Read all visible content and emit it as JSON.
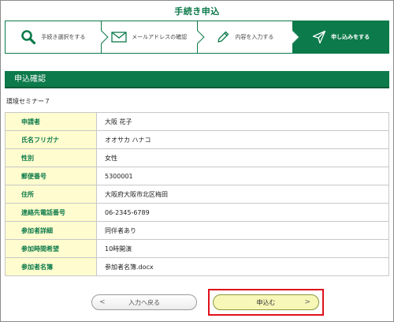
{
  "header": {
    "title": "手続き申込"
  },
  "steps": [
    {
      "label": "手続き選択をする",
      "icon": "search-icon",
      "active": false
    },
    {
      "label": "メールアドレスの確認",
      "icon": "mail-icon",
      "active": false
    },
    {
      "label": "内容を入力する",
      "icon": "pencil-icon",
      "active": false
    },
    {
      "label": "申し込みをする",
      "icon": "send-icon",
      "active": true
    }
  ],
  "section": {
    "title": "申込確認"
  },
  "event_name": "環境セミナー７",
  "fields": [
    {
      "key": "申請者",
      "value": "大阪 花子"
    },
    {
      "key": "氏名フリガナ",
      "value": "オオサカ ハナコ"
    },
    {
      "key": "性別",
      "value": "女性"
    },
    {
      "key": "郵便番号",
      "value": "5300001"
    },
    {
      "key": "住所",
      "value": "大阪府大阪市北区梅田"
    },
    {
      "key": "連絡先電話番号",
      "value": "06-2345-6789"
    },
    {
      "key": "参加者詳細",
      "value": "同伴者あり"
    },
    {
      "key": "参加時間希望",
      "value": "10時開演"
    },
    {
      "key": "参加者名簿",
      "value": "参加者名簿.docx"
    }
  ],
  "buttons": {
    "back_label": "入力へ戻る",
    "back_chevron": "<",
    "submit_label": "申込む",
    "submit_chevron": ">"
  },
  "colors": {
    "brand_green": "#0c7a4a",
    "key_cell_bg": "#fffccf",
    "submit_bg": "#f7f7b8",
    "highlight": "#e0101b"
  }
}
